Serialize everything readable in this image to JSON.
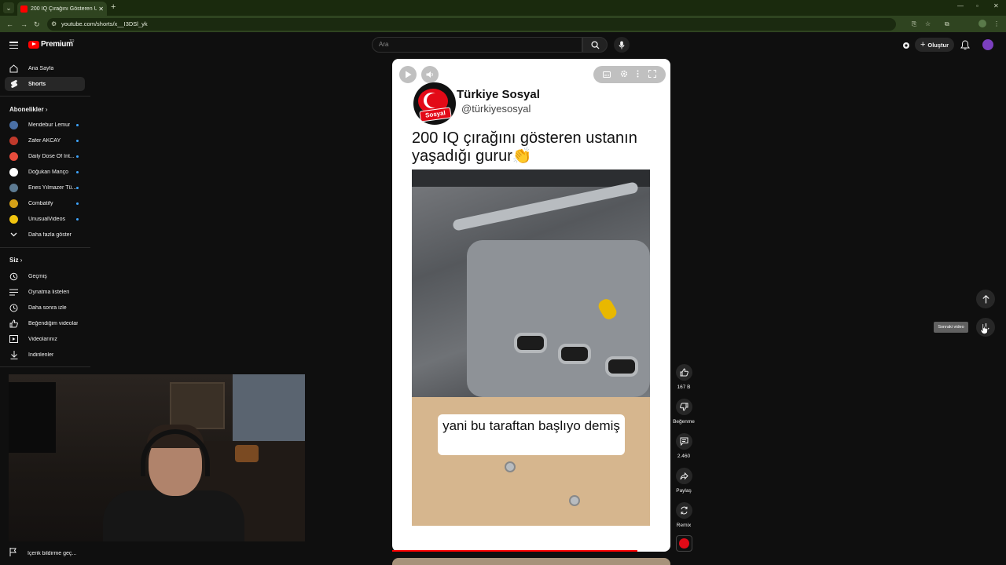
{
  "browser": {
    "tab_title": "200 IQ Çırağını Gösteren Ustan",
    "url": "youtube.com/shorts/x__I3DSl_yk"
  },
  "header": {
    "logo_text": "Premium",
    "logo_region": "TR",
    "search_placeholder": "Ara",
    "create_label": "Oluştur"
  },
  "sidebar": {
    "main": [
      {
        "label": "Ana Sayfa",
        "icon": "home-icon"
      },
      {
        "label": "Shorts",
        "icon": "shorts-icon",
        "active": true
      }
    ],
    "subscriptions_title": "Abonelikler",
    "subscriptions": [
      {
        "label": "Mendebur Lemur",
        "color": "#4a6fa5"
      },
      {
        "label": "Zafer AKCAY",
        "color": "#c0392b"
      },
      {
        "label": "Daily Dose Of Int...",
        "color": "#e74c3c"
      },
      {
        "label": "Doğukan Manço",
        "color": "#ffffff"
      },
      {
        "label": "Enes Yılmazer Tü...",
        "color": "#5d7b93"
      },
      {
        "label": "Combatify",
        "color": "#d4a017"
      },
      {
        "label": "UnusualVideos",
        "color": "#f1c40f"
      }
    ],
    "show_more": "Daha fazla göster",
    "you_title": "Siz",
    "you_items": [
      {
        "label": "Geçmiş",
        "icon": "history-icon"
      },
      {
        "label": "Oynatma listeleri",
        "icon": "playlist-icon"
      },
      {
        "label": "Daha sonra izle",
        "icon": "clock-icon"
      },
      {
        "label": "Beğendiğim videolar",
        "icon": "thumbs-up-icon"
      },
      {
        "label": "Videolarınız",
        "icon": "video-icon"
      },
      {
        "label": "İndirilenler",
        "icon": "download-icon"
      }
    ],
    "report_label": "İçerik bildirme geç..."
  },
  "short": {
    "channel_name": "Türkiye Sosyal",
    "channel_handle": "@türkiyesosyal",
    "logo_text": "Sosyal",
    "post_text": "200 IQ çırağını gösteren ustanın yaşadığı gurur👏",
    "caption": "yani bu taraftan başlıyo demiş",
    "progress_fraction": 0.88
  },
  "actions": {
    "like_count": "167 B",
    "dislike_label": "Beğenme",
    "comment_count": "2.460",
    "share_label": "Paylaş",
    "remix_label": "Remix"
  },
  "nav": {
    "next_tooltip": "Sonraki video"
  }
}
